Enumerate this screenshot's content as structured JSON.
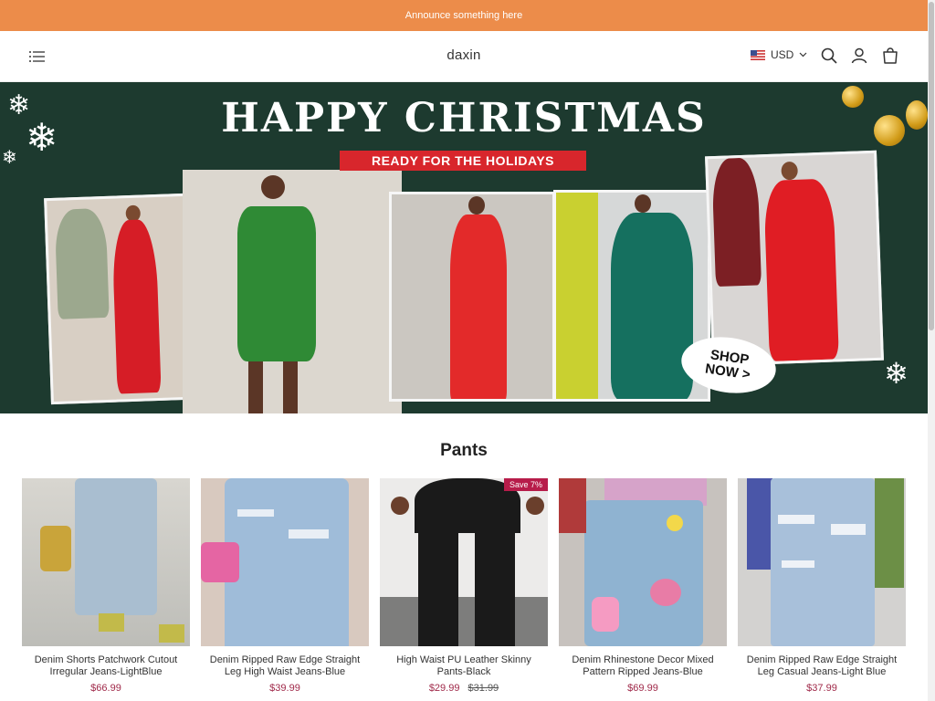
{
  "announcement": "Announce something here",
  "header": {
    "logo": "daxin",
    "currency": "USD"
  },
  "banner": {
    "title": "HAPPY CHRISTMAS",
    "subtitle": "READY FOR THE HOLIDAYS",
    "cta_line1": "SHOP",
    "cta_line2": "NOW >"
  },
  "section": {
    "title": "Pants"
  },
  "products": [
    {
      "name": "Denim Shorts Patchwork Cutout Irregular Jeans-LightBlue",
      "price": "$66.99",
      "old_price": "",
      "badge": ""
    },
    {
      "name": "Denim Ripped Raw Edge Straight Leg High Waist Jeans-Blue",
      "price": "$39.99",
      "old_price": "",
      "badge": ""
    },
    {
      "name": "High Waist PU Leather Skinny Pants-Black",
      "price": "$29.99",
      "old_price": "$31.99",
      "badge": "Save 7%"
    },
    {
      "name": "Denim Rhinestone Decor Mixed Pattern Ripped Jeans-Blue",
      "price": "$69.99",
      "old_price": "",
      "badge": ""
    },
    {
      "name": "Denim Ripped Raw Edge Straight Leg Casual Jeans-Light Blue",
      "price": "$37.99",
      "old_price": "",
      "badge": ""
    }
  ],
  "colors": {
    "announce_bg": "#ec8c4a",
    "banner_bg": "#1d3a2f",
    "price": "#a02a4a",
    "badge_bg": "#b71c4a"
  }
}
